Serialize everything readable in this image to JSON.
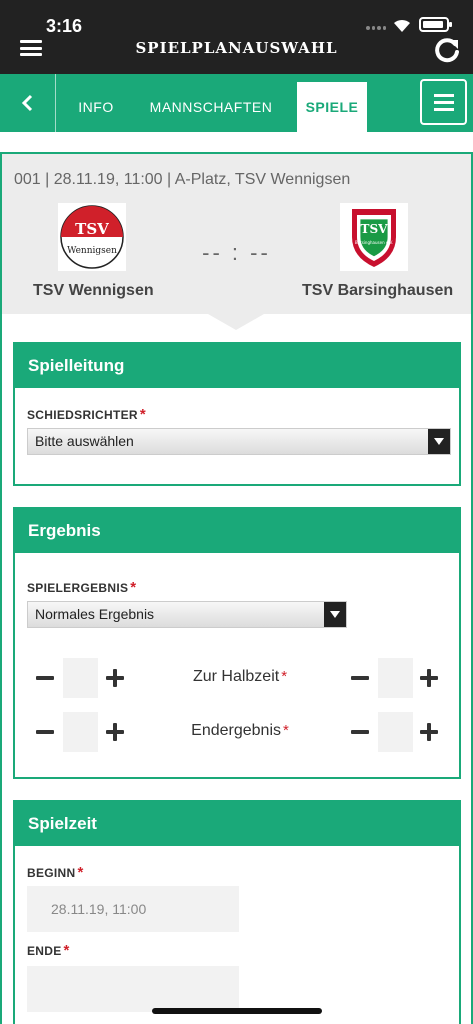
{
  "status": {
    "time": "3:16"
  },
  "header": {
    "title": "SPIELPLANAUSWAHL"
  },
  "tabs": {
    "info": "INFO",
    "teams": "MANNSCHAFTEN",
    "games": "SPIELE",
    "active": "SPIELE"
  },
  "match": {
    "info": "001 | 28.11.19, 11:00 | A-Platz, TSV Wennigsen",
    "score": "-- : --",
    "home": {
      "name": "TSV Wennigsen",
      "logo_text": "TSV",
      "logo_sub": "Wennigsen"
    },
    "away": {
      "name": "TSV Barsinghausen",
      "logo_text": "TSV",
      "logo_sub": "Barsinghausen e.V."
    }
  },
  "sections": {
    "officials": {
      "title": "Spielleitung",
      "referee_label": "SCHIEDSRICHTER",
      "referee_value": "Bitte auswählen",
      "required_mark": "*"
    },
    "result": {
      "title": "Ergebnis",
      "result_label": "SPIELERGEBNIS",
      "result_value": "Normales Ergebnis",
      "halftime_label": "Zur Halbzeit",
      "final_label": "Endergebnis",
      "required_mark": "*"
    },
    "playtime": {
      "title": "Spielzeit",
      "start_label": "BEGINN",
      "start_value": "28.11.19, 11:00",
      "end_label": "ENDE",
      "end_value": "",
      "required_mark": "*"
    }
  },
  "colors": {
    "primary": "#1aa979",
    "header": "#222222",
    "required": "#d0202a",
    "home_logo": "#d0202a",
    "away_logo": "#c8102e"
  },
  "icons": [
    "menu-icon",
    "refresh-icon",
    "back-chevron-icon",
    "hamburger-icon",
    "select-arrow-icon",
    "minus-icon",
    "plus-icon"
  ]
}
